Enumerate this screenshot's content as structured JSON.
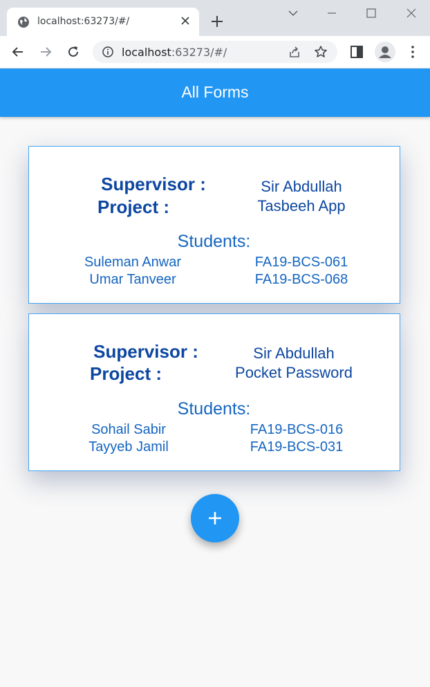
{
  "browser": {
    "tab_title": "localhost:63273/#/",
    "url_host": "localhost",
    "url_rest": ":63273/#/"
  },
  "app": {
    "title": "All Forms",
    "colors": {
      "primary": "#2196f3",
      "label": "#0d47a1",
      "student_text": "#1565c0"
    }
  },
  "labels": {
    "supervisor": "Supervisor  :",
    "project": "Project  :",
    "students": "Students:"
  },
  "forms": [
    {
      "supervisor": "Sir Abdullah",
      "project": "Tasbeeh App",
      "students": [
        {
          "name": "Suleman Anwar",
          "reg": "FA19-BCS-061"
        },
        {
          "name": "Umar Tanveer",
          "reg": "FA19-BCS-068"
        }
      ]
    },
    {
      "supervisor": "Sir Abdullah",
      "project": "Pocket Password",
      "students": [
        {
          "name": "Sohail Sabir",
          "reg": "FA19-BCS-016"
        },
        {
          "name": "Tayyeb Jamil",
          "reg": "FA19-BCS-031"
        }
      ]
    }
  ],
  "icons": {
    "fab": "add-icon"
  }
}
